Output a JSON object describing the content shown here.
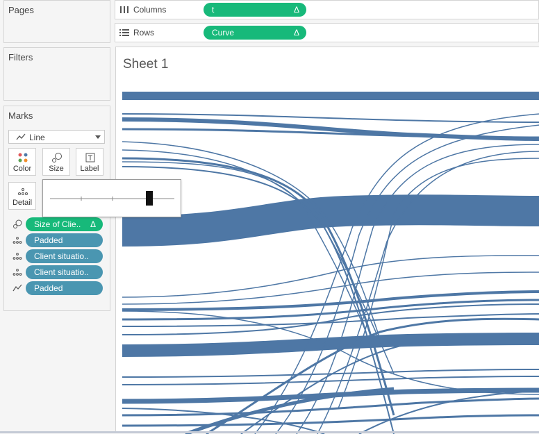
{
  "panels": {
    "pages": "Pages",
    "filters": "Filters",
    "marks": "Marks"
  },
  "shelves": {
    "columns": {
      "label": "Columns",
      "pill": "t",
      "delta": "Δ"
    },
    "rows": {
      "label": "Rows",
      "pill": "Curve",
      "delta": "Δ"
    }
  },
  "marks": {
    "type": "Line",
    "buttons": {
      "color": "Color",
      "size": "Size",
      "label": "Label",
      "detail": "Detail"
    },
    "pills": [
      {
        "icon": "size-icon",
        "label": "Size of Clie..",
        "delta": "Δ",
        "color": "#17b97a"
      },
      {
        "icon": "detail-icon",
        "label": "Padded",
        "color": "#4a96b1"
      },
      {
        "icon": "detail-icon",
        "label": "Client situatio..",
        "color": "#4a96b1"
      },
      {
        "icon": "detail-icon",
        "label": "Client situatio..",
        "color": "#4a96b1"
      },
      {
        "icon": "path-icon",
        "label": "Padded",
        "color": "#4a96b1"
      }
    ],
    "size_slider": {
      "level": 0.8
    }
  },
  "sheet": {
    "title": "Sheet 1"
  },
  "colors": {
    "accent_green": "#17b97a",
    "pill_blue": "#4a96b1",
    "curve": "#4e77a5"
  }
}
